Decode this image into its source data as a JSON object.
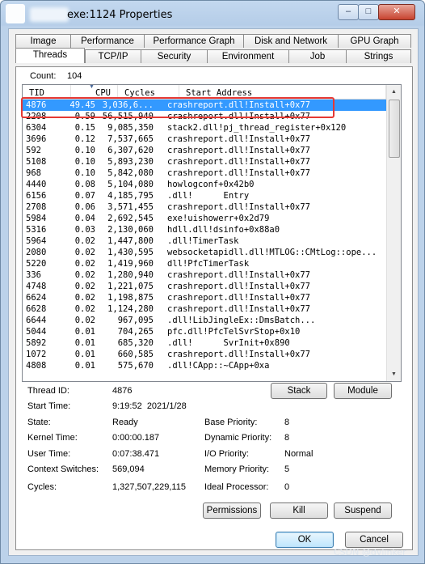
{
  "window": {
    "title": "exe:1124 Properties",
    "controls": {
      "minimize": "–",
      "maximize": "□",
      "close": "✕"
    }
  },
  "tabs_row1": [
    "Image",
    "Performance",
    "Performance Graph",
    "Disk and Network",
    "GPU Graph"
  ],
  "tabs_row2": [
    "Threads",
    "TCP/IP",
    "Security",
    "Environment",
    "Job",
    "Strings"
  ],
  "count": {
    "label": "Count:",
    "value": "104"
  },
  "columns": [
    "TID",
    "CPU",
    "Cycles",
    "Start Address"
  ],
  "threads": [
    {
      "tid": "4876",
      "cpu": "49.45",
      "cycles": "3,036,6...",
      "address": "crashreport.dll!Install+0x77"
    },
    {
      "tid": "2208",
      "cpu": "0.59",
      "cycles": "56,515,940",
      "address": "crashreport.dll!Install+0x77"
    },
    {
      "tid": "6304",
      "cpu": "0.15",
      "cycles": "9,085,350",
      "address": "stack2.dll!pj_thread_register+0x120"
    },
    {
      "tid": "3696",
      "cpu": "0.12",
      "cycles": "7,537,665",
      "address": "crashreport.dll!Install+0x77"
    },
    {
      "tid": "592",
      "cpu": "0.10",
      "cycles": "6,307,620",
      "address": "crashreport.dll!Install+0x77"
    },
    {
      "tid": "5108",
      "cpu": "0.10",
      "cycles": "5,893,230",
      "address": "crashreport.dll!Install+0x77"
    },
    {
      "tid": "968",
      "cpu": "0.10",
      "cycles": "5,842,080",
      "address": "crashreport.dll!Install+0x77"
    },
    {
      "tid": "4440",
      "cpu": "0.08",
      "cycles": "5,104,080",
      "address": "howlogconf+0x42b0"
    },
    {
      "tid": "6156",
      "cpu": "0.07",
      "cycles": "4,185,795",
      "address": ".dll!      Entry"
    },
    {
      "tid": "2708",
      "cpu": "0.06",
      "cycles": "3,571,455",
      "address": "crashreport.dll!Install+0x77"
    },
    {
      "tid": "5984",
      "cpu": "0.04",
      "cycles": "2,692,545",
      "address": "exe!uishowerr+0x2d79"
    },
    {
      "tid": "5316",
      "cpu": "0.03",
      "cycles": "2,130,060",
      "address": "hdll.dll!dsinfo+0x88a0"
    },
    {
      "tid": "5964",
      "cpu": "0.02",
      "cycles": "1,447,800",
      "address": ".dll!TimerTask"
    },
    {
      "tid": "2080",
      "cpu": "0.02",
      "cycles": "1,430,595",
      "address": "websocketapidll.dll!MTLOG::CMtLog::ope..."
    },
    {
      "tid": "5220",
      "cpu": "0.02",
      "cycles": "1,419,960",
      "address": "dll!PfcTimerTask"
    },
    {
      "tid": "336",
      "cpu": "0.02",
      "cycles": "1,280,940",
      "address": "crashreport.dll!Install+0x77"
    },
    {
      "tid": "4748",
      "cpu": "0.02",
      "cycles": "1,221,075",
      "address": "crashreport.dll!Install+0x77"
    },
    {
      "tid": "6624",
      "cpu": "0.02",
      "cycles": "1,198,875",
      "address": "crashreport.dll!Install+0x77"
    },
    {
      "tid": "6628",
      "cpu": "0.02",
      "cycles": "1,124,280",
      "address": "crashreport.dll!Install+0x77"
    },
    {
      "tid": "6644",
      "cpu": "0.02",
      "cycles": "967,095",
      "address": ".dll!LibJingleEx::DmsBatch..."
    },
    {
      "tid": "5044",
      "cpu": "0.01",
      "cycles": "704,265",
      "address": "pfc.dll!PfcTelSvrStop+0x10"
    },
    {
      "tid": "5892",
      "cpu": "0.01",
      "cycles": "685,320",
      "address": ".dll!      SvrInit+0x890"
    },
    {
      "tid": "1072",
      "cpu": "0.01",
      "cycles": "660,585",
      "address": "crashreport.dll!Install+0x77"
    },
    {
      "tid": "4808",
      "cpu": "0.01",
      "cycles": "575,670",
      "address": ".dll!CApp::~CApp+0xa"
    }
  ],
  "details": {
    "thread_id_label": "Thread ID:",
    "thread_id": "4876",
    "start_time_label": "Start Time:",
    "start_time": "9:19:52  2021/1/28",
    "state_label": "State:",
    "state": "Ready",
    "base_priority_label": "Base Priority:",
    "base_priority": "8",
    "kernel_time_label": "Kernel Time:",
    "kernel_time": "0:00:00.187",
    "dynamic_priority_label": "Dynamic Priority:",
    "dynamic_priority": "8",
    "user_time_label": "User Time:",
    "user_time": "0:07:38.471",
    "io_priority_label": "I/O Priority:",
    "io_priority": "Normal",
    "context_switches_label": "Context Switches:",
    "context_switches": "569,094",
    "memory_priority_label": "Memory Priority:",
    "memory_priority": "5",
    "cycles_label": "Cycles:",
    "cycles": "1,327,507,229,115",
    "ideal_processor_label": "Ideal Processor:",
    "ideal_processor": "0"
  },
  "buttons": {
    "stack": "Stack",
    "module": "Module",
    "permissions": "Permissions",
    "kill": "Kill",
    "suspend": "Suspend",
    "ok": "OK",
    "cancel": "Cancel"
  },
  "watermark": "CSDN @dvlinker",
  "colors": {
    "selection": "#3399ff",
    "highlight_box": "#e53935",
    "title_gradient_top": "#c3d8ef"
  }
}
